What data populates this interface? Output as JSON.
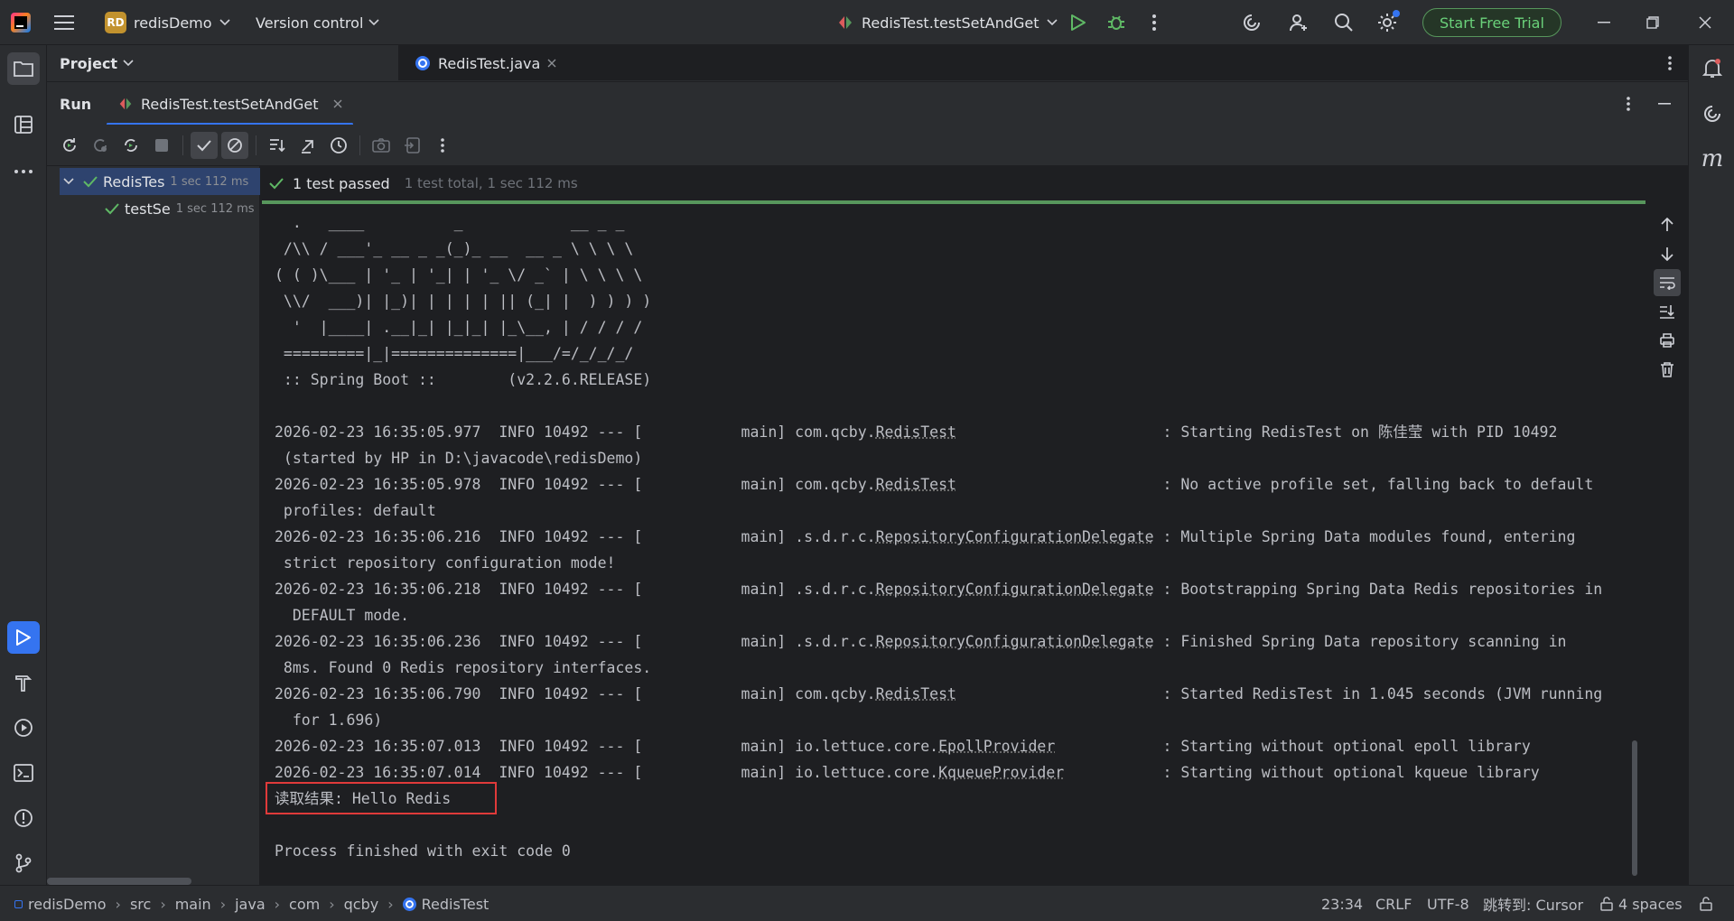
{
  "title_bar": {
    "project_badge": "RD",
    "project_name": "redisDemo",
    "version_control": "Version control",
    "run_config": "RedisTest.testSetAndGet",
    "trial_button": "Start Free Trial"
  },
  "project_panel": {
    "label": "Project"
  },
  "editor": {
    "tab_label": "RedisTest.java"
  },
  "run_window": {
    "title": "Run",
    "tab_label": "RedisTest.testSetAndGet"
  },
  "test_tree": {
    "root": {
      "label": "RedisTes",
      "time": "1 sec 112 ms"
    },
    "child": {
      "label": "testSe",
      "time": "1 sec 112 ms"
    }
  },
  "test_status": {
    "result": "1 test passed",
    "summary": "1 test total, 1 sec 112 ms"
  },
  "console": {
    "banner": [
      "  .   ____          _            __ _ _",
      " /\\\\ / ___'_ __ _ _(_)_ __  __ _ \\ \\ \\ \\",
      "( ( )\\___ | '_ | '_| | '_ \\/ _` | \\ \\ \\ \\",
      " \\\\/  ___)| |_)| | | | | || (_| |  ) ) ) )",
      "  '  |____| .__|_| |_|_| |_\\__, | / / / /",
      " =========|_|==============|___/=/_/_/_/",
      " :: Spring Boot ::        (v2.2.6.RELEASE)"
    ],
    "log_lines": [
      {
        "prefix": "2026-02-23 16:35:05.977  INFO 10492 --- [           main] com.qcby.",
        "cls": "RedisTest",
        "pad": "                       ",
        "msg": ": Starting RedisTest on 陈佳莹 with PID 10492",
        "cont": " (started by HP in D:\\javacode\\redisDemo)"
      },
      {
        "prefix": "2026-02-23 16:35:05.978  INFO 10492 --- [           main] com.qcby.",
        "cls": "RedisTest",
        "pad": "                       ",
        "msg": ": No active profile set, falling back to default",
        "cont": " profiles: default"
      },
      {
        "prefix": "2026-02-23 16:35:06.216  INFO 10492 --- [           main] .s.d.r.c.",
        "cls": "RepositoryConfigurationDelegate",
        "pad": " ",
        "msg": ": Multiple Spring Data modules found, entering",
        "cont": " strict repository configuration mode!"
      },
      {
        "prefix": "2026-02-23 16:35:06.218  INFO 10492 --- [           main] .s.d.r.c.",
        "cls": "RepositoryConfigurationDelegate",
        "pad": " ",
        "msg": ": Bootstrapping Spring Data Redis repositories in",
        "cont": "  DEFAULT mode."
      },
      {
        "prefix": "2026-02-23 16:35:06.236  INFO 10492 --- [           main] .s.d.r.c.",
        "cls": "RepositoryConfigurationDelegate",
        "pad": " ",
        "msg": ": Finished Spring Data repository scanning in",
        "cont": " 8ms. Found 0 Redis repository interfaces."
      },
      {
        "prefix": "2026-02-23 16:35:06.790  INFO 10492 --- [           main] com.qcby.",
        "cls": "RedisTest",
        "pad": "                       ",
        "msg": ": Started RedisTest in 1.045 seconds (JVM running",
        "cont": "  for 1.696)"
      },
      {
        "prefix": "2026-02-23 16:35:07.013  INFO 10492 --- [           main] io.lettuce.core.",
        "cls": "EpollProvider",
        "pad": "            ",
        "msg": ": Starting without optional epoll library",
        "cont": null
      },
      {
        "prefix": "2026-02-23 16:35:07.014  INFO 10492 --- [           main] io.lettuce.core.",
        "cls": "KqueueProvider",
        "pad": "           ",
        "msg": ": Starting without optional kqueue library",
        "cont": null
      }
    ],
    "result_line": "读取结果: Hello Redis",
    "exit_line": "Process finished with exit code 0"
  },
  "status_bar": {
    "breadcrumbs": [
      "redisDemo",
      "src",
      "main",
      "java",
      "com",
      "qcby",
      "RedisTest"
    ],
    "position": "23:34",
    "line_sep": "CRLF",
    "encoding": "UTF-8",
    "jump_to": "跳转到: Cursor",
    "indent": "4 spaces"
  },
  "colors": {
    "accent": "#3574f0",
    "success": "#57965c",
    "highlight_box": "#e03a3a"
  }
}
